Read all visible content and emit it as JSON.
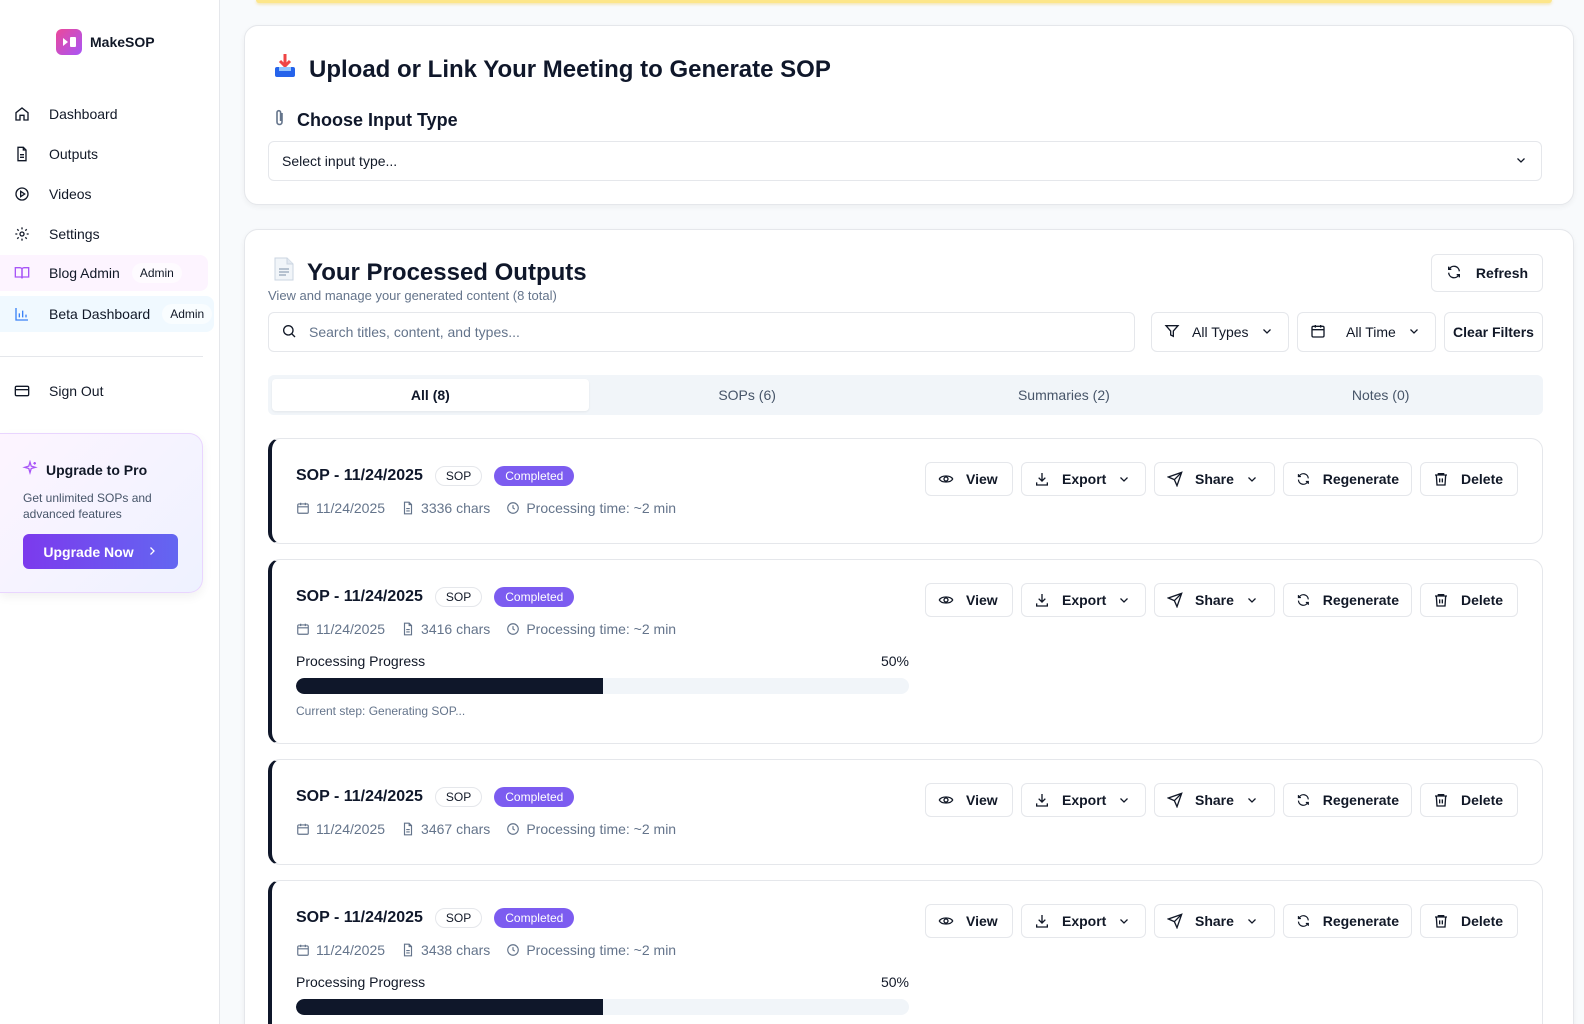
{
  "brand": {
    "name": "MakeSOP"
  },
  "sidebar": {
    "items": [
      {
        "label": "Dashboard"
      },
      {
        "label": "Outputs"
      },
      {
        "label": "Videos"
      },
      {
        "label": "Settings"
      },
      {
        "label": "Blog Admin",
        "badge": "Admin"
      },
      {
        "label": "Beta Dashboard",
        "badge": "Admin"
      }
    ],
    "signout": "Sign Out",
    "upgrade": {
      "title": "Upgrade to Pro",
      "desc": "Get unlimited SOPs and advanced features",
      "button": "Upgrade Now"
    }
  },
  "upload": {
    "title": "Upload or Link Your Meeting to Generate SOP",
    "choose_label": "Choose Input Type",
    "select_value": "Select input type..."
  },
  "outputs": {
    "title": "Your Processed Outputs",
    "subtitle": "View and manage your generated content (8 total)",
    "refresh": "Refresh",
    "search_placeholder": "Search titles, content, and types...",
    "filter_types": "All Types",
    "filter_time": "All Time",
    "clear": "Clear Filters",
    "tabs": [
      {
        "label": "All (8)"
      },
      {
        "label": "SOPs (6)"
      },
      {
        "label": "Summaries (2)"
      },
      {
        "label": "Notes (0)"
      }
    ],
    "actions": {
      "view": "View",
      "export": "Export",
      "share": "Share",
      "regenerate": "Regenerate",
      "delete": "Delete"
    },
    "items": [
      {
        "title": "SOP - 11/24/2025",
        "type": "SOP",
        "status": "Completed",
        "date": "11/24/2025",
        "chars": "3336 chars",
        "time": "Processing time: ~2 min"
      },
      {
        "title": "SOP - 11/24/2025",
        "type": "SOP",
        "status": "Completed",
        "date": "11/24/2025",
        "chars": "3416 chars",
        "time": "Processing time: ~2 min",
        "progress_label": "Processing Progress",
        "progress_pct": "50%",
        "progress": 50,
        "step": "Current step: Generating SOP..."
      },
      {
        "title": "SOP - 11/24/2025",
        "type": "SOP",
        "status": "Completed",
        "date": "11/24/2025",
        "chars": "3467 chars",
        "time": "Processing time: ~2 min"
      },
      {
        "title": "SOP - 11/24/2025",
        "type": "SOP",
        "status": "Completed",
        "date": "11/24/2025",
        "chars": "3438 chars",
        "time": "Processing time: ~2 min",
        "progress_label": "Processing Progress",
        "progress_pct": "50%",
        "progress": 50
      }
    ]
  },
  "colors": {
    "accent": "#7c5cf0",
    "dark": "#0f172a",
    "upgrade": "#7c3aed"
  }
}
